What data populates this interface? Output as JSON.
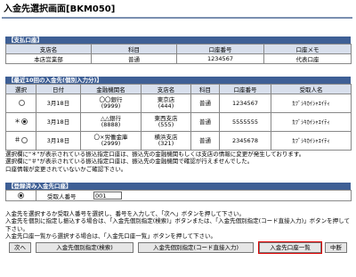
{
  "page_title": "入金先選択画面[BKM050]",
  "payer": {
    "section_title": "【支払口座】",
    "headers": [
      "支店名",
      "科目",
      "口座番号",
      "口座メモ"
    ],
    "row": [
      "本店営業部",
      "普通",
      "1234567",
      "代表口座"
    ]
  },
  "recent": {
    "section_title": "【最近10回の入金先(個別入力分)】",
    "headers": [
      "選択",
      "日付",
      "金融機関名",
      "支店名",
      "科目",
      "口座番号",
      "受取人名"
    ],
    "rows": [
      {
        "mark": "",
        "selected": false,
        "date": "3月18日",
        "bank": "〇〇銀行",
        "bank_code": "(9999)",
        "branch": "東京店",
        "branch_code": "(444)",
        "type": "普通",
        "account": "1234567",
        "payee": "ｶﾌﾞｼｷｶｲｼｬｴｲﾃｨ"
      },
      {
        "mark": "＊",
        "selected": true,
        "date": "3月18日",
        "bank": "△△銀行",
        "bank_code": "(8888)",
        "branch": "東西支店",
        "branch_code": "(555)",
        "type": "普通",
        "account": "5555555",
        "payee": "ｶﾌﾞｼｷｶｲｼｬｴｲﾃｨ"
      },
      {
        "mark": "＃",
        "selected": false,
        "date": "3月18日",
        "bank": "〇×労働金庫",
        "bank_code": "(2999)",
        "branch": "横浜支店",
        "branch_code": "(321)",
        "type": "普通",
        "account": "2345678",
        "payee": "ｶﾌﾞｼｷｶｲｼｬｴｲﾃｨ"
      }
    ],
    "notes": [
      "選択欄に\"＊\"が表示されている振込指定口座は、振込先の金融機関もしくは支店の情報に変更が発生しております。",
      "選択欄に\"＃\"が表示されている振込指定口座は、振込先の金融機関で確認が行えませんでした。",
      "口座情報が変更されていないかご確認下さい。"
    ]
  },
  "registered": {
    "section_title": "【登録済み入金先口座】",
    "label": "受取人番号",
    "value": "001"
  },
  "instructions": [
    "入金先を選択するか受取人番号を選択し、番号を入力して、「次へ」ボタンを押して下さい。",
    "入金先を個別に指定し振込する場合は、「入金先個別指定(検索)」ボタンまたは、「入金先個別指定(コード直接入力)」ボタンを押して下さい。",
    "入金先口座一覧から選択する場合は、「入金先口座一覧」ボタンを押して下さい。"
  ],
  "buttons": {
    "next": "次へ",
    "search": "入金先個別指定(検索)",
    "code": "入金先個別指定(コード直接入力)",
    "list": "入金先口座一覧",
    "abort": "中断"
  },
  "colors": {
    "section_bg": "#3e5f95",
    "header_bg": "#d8dfec",
    "highlight": "#e00000"
  }
}
